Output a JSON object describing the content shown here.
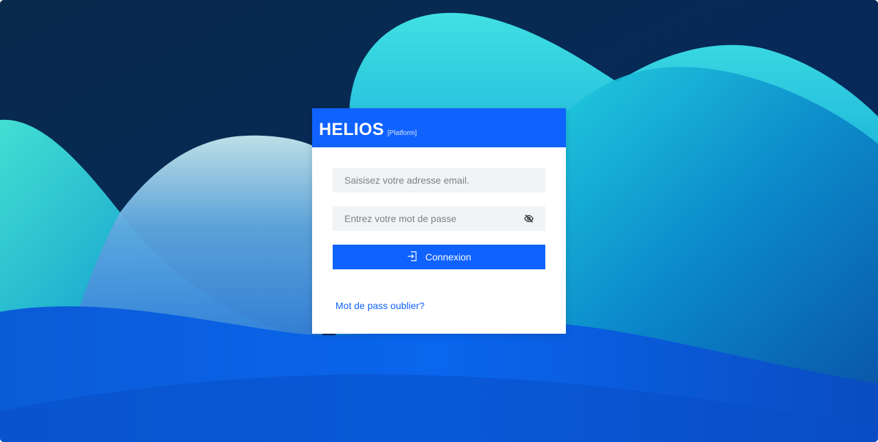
{
  "brand": {
    "name": "HELIOS",
    "tag": "[Platform]",
    "color": "#0f62fe"
  },
  "login": {
    "email_placeholder": "Saisisez votre adresse email.",
    "password_placeholder": "Entrez votre mot de passe",
    "toggle_password_icon": "eye-off-icon",
    "submit_icon": "login-icon",
    "submit_label": "Connexion",
    "forgot_link": "Mot de pass oublier?"
  }
}
